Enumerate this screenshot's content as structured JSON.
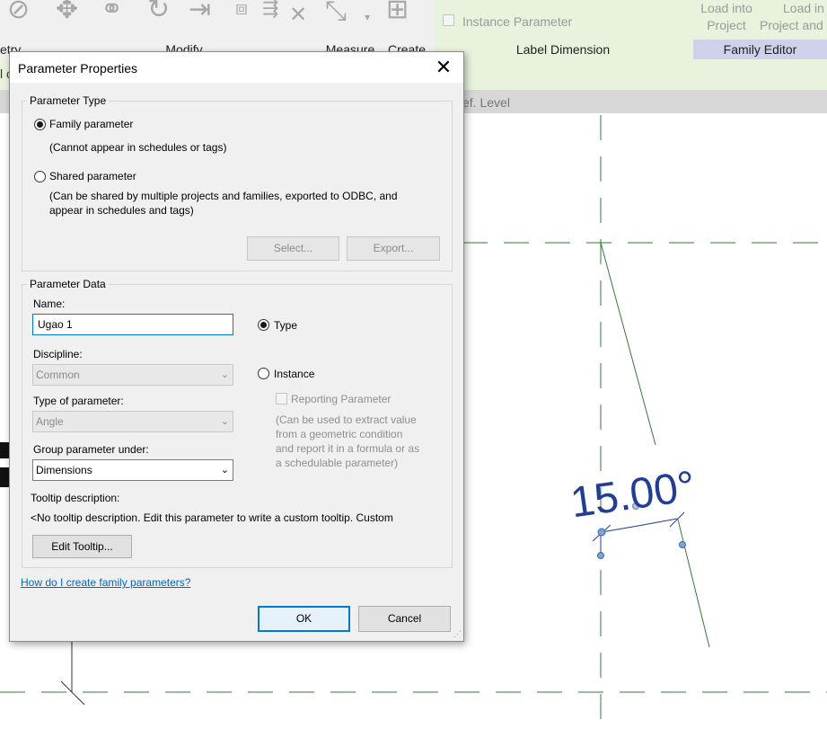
{
  "ribbon": {
    "panels": {
      "geometry_partial": "etry",
      "modify": "Modify",
      "measure": "Measure",
      "create": "Create",
      "label_dimension": "Label Dimension",
      "family_editor": "Family Editor"
    },
    "instance_parameter_label": "Instance Parameter",
    "load_into_project": {
      "line1": "Load into",
      "line2": "Project"
    },
    "load_into_project_and": {
      "line1": "Load in",
      "line2": "Project and"
    }
  },
  "view": {
    "ref_level_partial": "ef. Level",
    "left_partial": "l c",
    "dimension_value": "15.00°"
  },
  "dialog": {
    "title": "Parameter Properties",
    "parameter_type": {
      "group_label": "Parameter Type",
      "family": {
        "label": "Family parameter",
        "note": "(Cannot appear in schedules or tags)",
        "selected": true
      },
      "shared": {
        "label": "Shared parameter",
        "note_line1": "(Can be shared by multiple projects and families, exported to ODBC, and",
        "note_line2": "appear in schedules and tags)",
        "selected": false
      },
      "select_button": "Select...",
      "export_button": "Export..."
    },
    "parameter_data": {
      "group_label": "Parameter Data",
      "name_label": "Name:",
      "name_value": "Ugao 1",
      "discipline_label": "Discipline:",
      "discipline_value": "Common",
      "type_of_parameter_label": "Type of parameter:",
      "type_of_parameter_value": "Angle",
      "group_under_label": "Group parameter under:",
      "group_under_value": "Dimensions",
      "type_option": {
        "label": "Type",
        "selected": true
      },
      "instance_option": {
        "label": "Instance",
        "selected": false
      },
      "reporting_label": "Reporting Parameter",
      "reporting_note": [
        "(Can be used to extract value",
        "from a geometric condition",
        "and report it in a formula or as",
        "a schedulable parameter)"
      ],
      "tooltip_label": "Tooltip description:",
      "tooltip_value": "<No tooltip description. Edit this parameter to write a custom tooltip. Custom",
      "edit_tooltip_button": "Edit Tooltip..."
    },
    "help_link": "How do I create family parameters?",
    "ok_button": "OK",
    "cancel_button": "Cancel"
  }
}
